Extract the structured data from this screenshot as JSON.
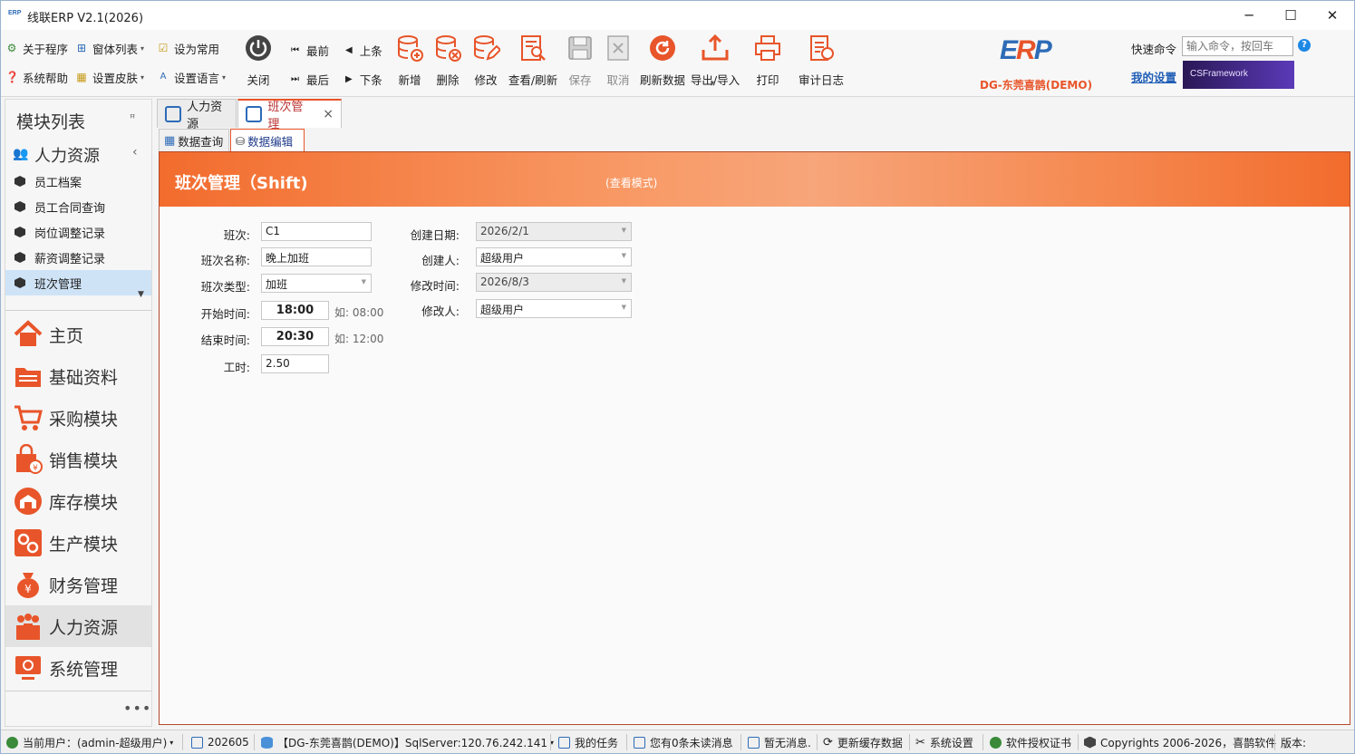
{
  "window": {
    "title": "线联ERP V2.1(2026)",
    "logo_text": "ERP",
    "minimize": "─",
    "maximize": "☐",
    "close": "✕"
  },
  "ribbon": {
    "small": [
      {
        "label": "关于程序"
      },
      {
        "label": "窗体列表"
      },
      {
        "label": "设为常用"
      },
      {
        "label": "系统帮助"
      },
      {
        "label": "设置皮肤"
      },
      {
        "label": "设置语言"
      }
    ],
    "close": "关闭",
    "nav": {
      "first": "最前",
      "prev": "上条",
      "last": "最后",
      "next": "下条"
    },
    "buttons": {
      "add": "新增",
      "delete": "删除",
      "edit": "修改",
      "view_refresh": "查看/刷新",
      "save": "保存",
      "cancel": "取消",
      "refresh_data": "刷新数据",
      "export_import": "导出/导入",
      "print": "打印",
      "audit_log": "审计日志"
    },
    "brand": {
      "logo": "ERP",
      "company": "DG-东莞喜鹊(DEMO)"
    },
    "quick_command": {
      "label": "快速命令",
      "placeholder": "输入命令，按回车"
    },
    "help": "?",
    "my_settings": "我的设置",
    "framework": "CSFramework"
  },
  "sidebar": {
    "title": "模块列表",
    "pin": "ꟸ",
    "group": "人力资源",
    "items": [
      "员工档案",
      "员工合同查询",
      "岗位调整记录",
      "薪资调整记录",
      "班次管理"
    ],
    "modules": [
      "主页",
      "基础资料",
      "采购模块",
      "销售模块",
      "库存模块",
      "生产模块",
      "财务管理",
      "人力资源",
      "系统管理"
    ],
    "more": "•••"
  },
  "tabs": {
    "main": [
      "人力资源",
      "班次管理"
    ],
    "close": "×",
    "sub": [
      "数据查询",
      "数据编辑"
    ]
  },
  "form": {
    "title": "班次管理（Shift)",
    "mode": "(查看模式)",
    "labels": {
      "shift": "班次:",
      "shift_name": "班次名称:",
      "shift_type": "班次类型:",
      "start_time": "开始时间:",
      "end_time": "结束时间:",
      "work_hours": "工时:",
      "created_date": "创建日期:",
      "creator": "创建人:",
      "modified_time": "修改时间:",
      "modifier": "修改人:"
    },
    "values": {
      "shift": "C1",
      "shift_name": "晚上加班",
      "shift_type": "加班",
      "start_time": "18:00",
      "end_time": "20:30",
      "work_hours": "2.50",
      "created_date": "2026/2/1",
      "creator": "超级用户",
      "modified_time": "2026/8/3",
      "modifier": "超级用户"
    },
    "hints": {
      "start": "如: 08:00",
      "end": "如: 12:00"
    }
  },
  "status": {
    "user": "当前用户：(admin-超级用户)",
    "period": "202605",
    "db": "【DG-东莞喜鹊(DEMO)】SqlServer:120.76.242.141",
    "tasks": "我的任务",
    "messages": "您有0条未读消息",
    "notice": "暂无消息.",
    "cache": "更新缓存数据",
    "settings": "系统设置",
    "license": "软件授权证书",
    "copyright": "Copyrights 2006-2026，喜鹊软件",
    "version": "版本:"
  },
  "colors": {
    "accent": "#e8552a",
    "blue": "#2d6bb7",
    "selection": "#cfe3f7"
  }
}
